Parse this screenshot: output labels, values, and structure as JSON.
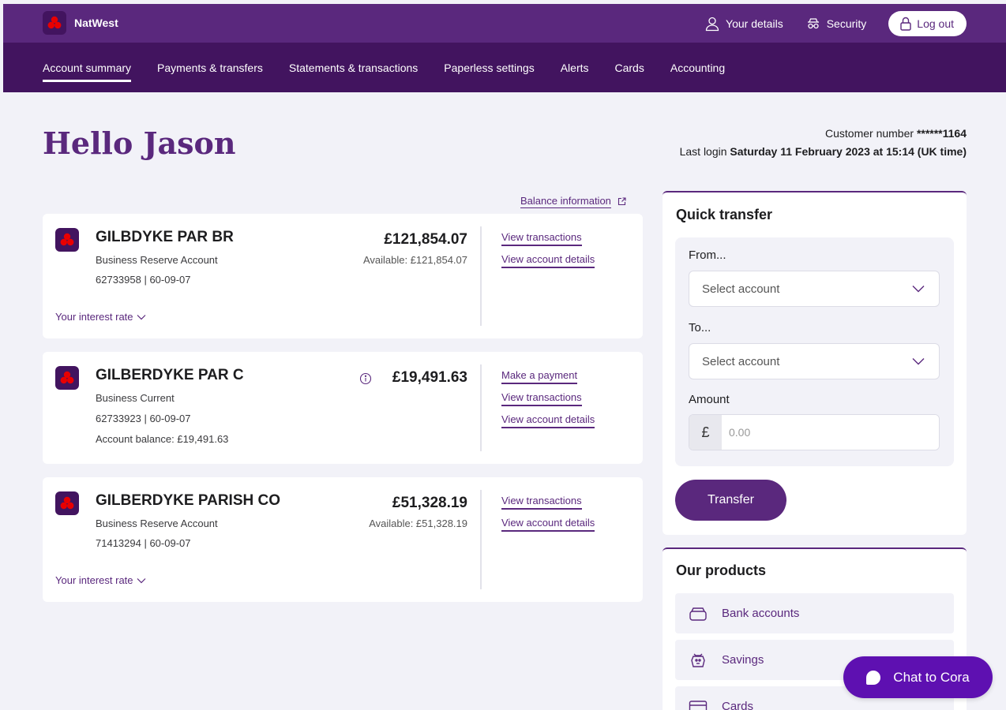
{
  "header": {
    "brand": "NatWest",
    "your_details": "Your details",
    "security": "Security",
    "logout": "Log out"
  },
  "nav": {
    "items": [
      {
        "label": "Account summary",
        "active": true
      },
      {
        "label": "Payments & transfers"
      },
      {
        "label": "Statements & transactions"
      },
      {
        "label": "Paperless settings"
      },
      {
        "label": "Alerts"
      },
      {
        "label": "Cards"
      },
      {
        "label": "Accounting"
      }
    ]
  },
  "greeting": "Hello Jason",
  "meta": {
    "customer_label": "Customer number",
    "customer_number": "******1164",
    "last_login_label": "Last login",
    "last_login_value": "Saturday 11 February 2023 at 15:14 (UK time)"
  },
  "balance_information": "Balance information",
  "accounts": [
    {
      "name": "GILBDYKE PAR BR",
      "type": "Business Reserve Account",
      "number": "62733958 | 60-09-07",
      "amount": "£121,854.07",
      "available": "Available: £121,854.07",
      "links": [
        "View transactions",
        "View account details"
      ],
      "interest": "Your interest rate"
    },
    {
      "name": "GILBERDYKE PAR C",
      "type": "Business Current",
      "number": "62733923 | 60-09-07",
      "balance_line": "Account balance: £19,491.63",
      "amount": "£19,491.63",
      "links": [
        "Make a payment",
        "View transactions",
        "View account details"
      ]
    },
    {
      "name": "GILBERDYKE PARISH CO",
      "type": "Business Reserve Account",
      "number": "71413294 | 60-09-07",
      "amount": "£51,328.19",
      "available": "Available: £51,328.19",
      "links": [
        "View transactions",
        "View account details"
      ],
      "interest": "Your interest rate"
    }
  ],
  "quick_transfer": {
    "title": "Quick transfer",
    "from_label": "From...",
    "from_placeholder": "Select account",
    "to_label": "To...",
    "to_placeholder": "Select account",
    "amount_label": "Amount",
    "currency_symbol": "£",
    "amount_placeholder": "0.00",
    "button": "Transfer"
  },
  "products": {
    "title": "Our products",
    "items": [
      {
        "label": "Bank accounts",
        "icon": "wallet-icon"
      },
      {
        "label": "Savings",
        "icon": "piggy-bank-icon"
      },
      {
        "label": "Cards",
        "icon": "credit-card-icon"
      }
    ]
  },
  "chat": {
    "label": "Chat to Cora"
  },
  "colors": {
    "brand_purple": "#5a287d",
    "nav_purple": "#42145f",
    "chat_purple": "#5e10b1",
    "logo_red": "#e90000"
  }
}
